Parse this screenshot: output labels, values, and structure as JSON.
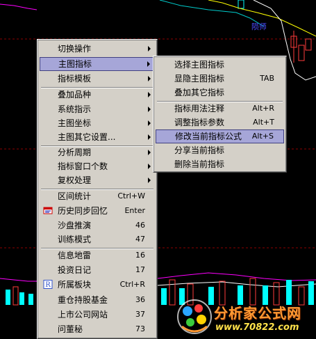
{
  "chart": {
    "label": "陨师",
    "colors": {
      "bar_cyan": "#00ffff",
      "bar_red": "#ff3b3b",
      "line_magenta": "#ff00ff",
      "line_white": "#ffffff",
      "line_yellow": "#ffff00",
      "grid_red": "#8b0000"
    }
  },
  "main_menu": {
    "items": [
      {
        "label": "切换操作",
        "arrow": true
      },
      {
        "label": "主图指标",
        "arrow": true,
        "highlighted": true
      },
      {
        "label": "指标模板",
        "arrow": true
      },
      {
        "label": "叠加品种",
        "arrow": true
      },
      {
        "label": "系统指示",
        "arrow": true
      },
      {
        "label": "主图坐标",
        "arrow": true
      },
      {
        "label": "主图其它设置...",
        "arrow": true
      },
      {
        "label": "分析周期",
        "arrow": true
      },
      {
        "label": "指标窗口个数",
        "arrow": true
      },
      {
        "label": "复权处理",
        "arrow": true
      },
      {
        "label": "区间统计",
        "shortcut": "Ctrl+W"
      },
      {
        "label": "历史同步回忆",
        "shortcut": "Enter",
        "icon": "history-sync-icon"
      },
      {
        "label": "沙盘推演",
        "shortcut": "46"
      },
      {
        "label": "训练模式",
        "shortcut": "47"
      },
      {
        "label": "信息地雷",
        "shortcut": "16"
      },
      {
        "label": "投资日记",
        "shortcut": "17"
      },
      {
        "label": "所属板块",
        "shortcut": "Ctrl+R",
        "icon": "sector-r-icon"
      },
      {
        "label": "重仓持股基金",
        "shortcut": "36"
      },
      {
        "label": "上市公司网站",
        "shortcut": "37"
      },
      {
        "label": "问董秘",
        "shortcut": "73"
      }
    ]
  },
  "sub_menu": {
    "items": [
      {
        "label": "选择主图指标",
        "shortcut": ""
      },
      {
        "label": "显隐主图指标",
        "shortcut": "TAB"
      },
      {
        "label": "叠加其它指标",
        "shortcut": ""
      },
      {
        "label": "指标用法注释",
        "shortcut": "Alt+R"
      },
      {
        "label": "调整指标参数",
        "shortcut": "Alt+T"
      },
      {
        "label": "修改当前指标公式",
        "shortcut": "Alt+S",
        "highlighted": true
      },
      {
        "label": "分享当前指标",
        "shortcut": ""
      },
      {
        "label": "删除当前指标",
        "shortcut": ""
      }
    ]
  },
  "watermark": {
    "title": "分析家公式网",
    "url": "www.70822.com"
  }
}
